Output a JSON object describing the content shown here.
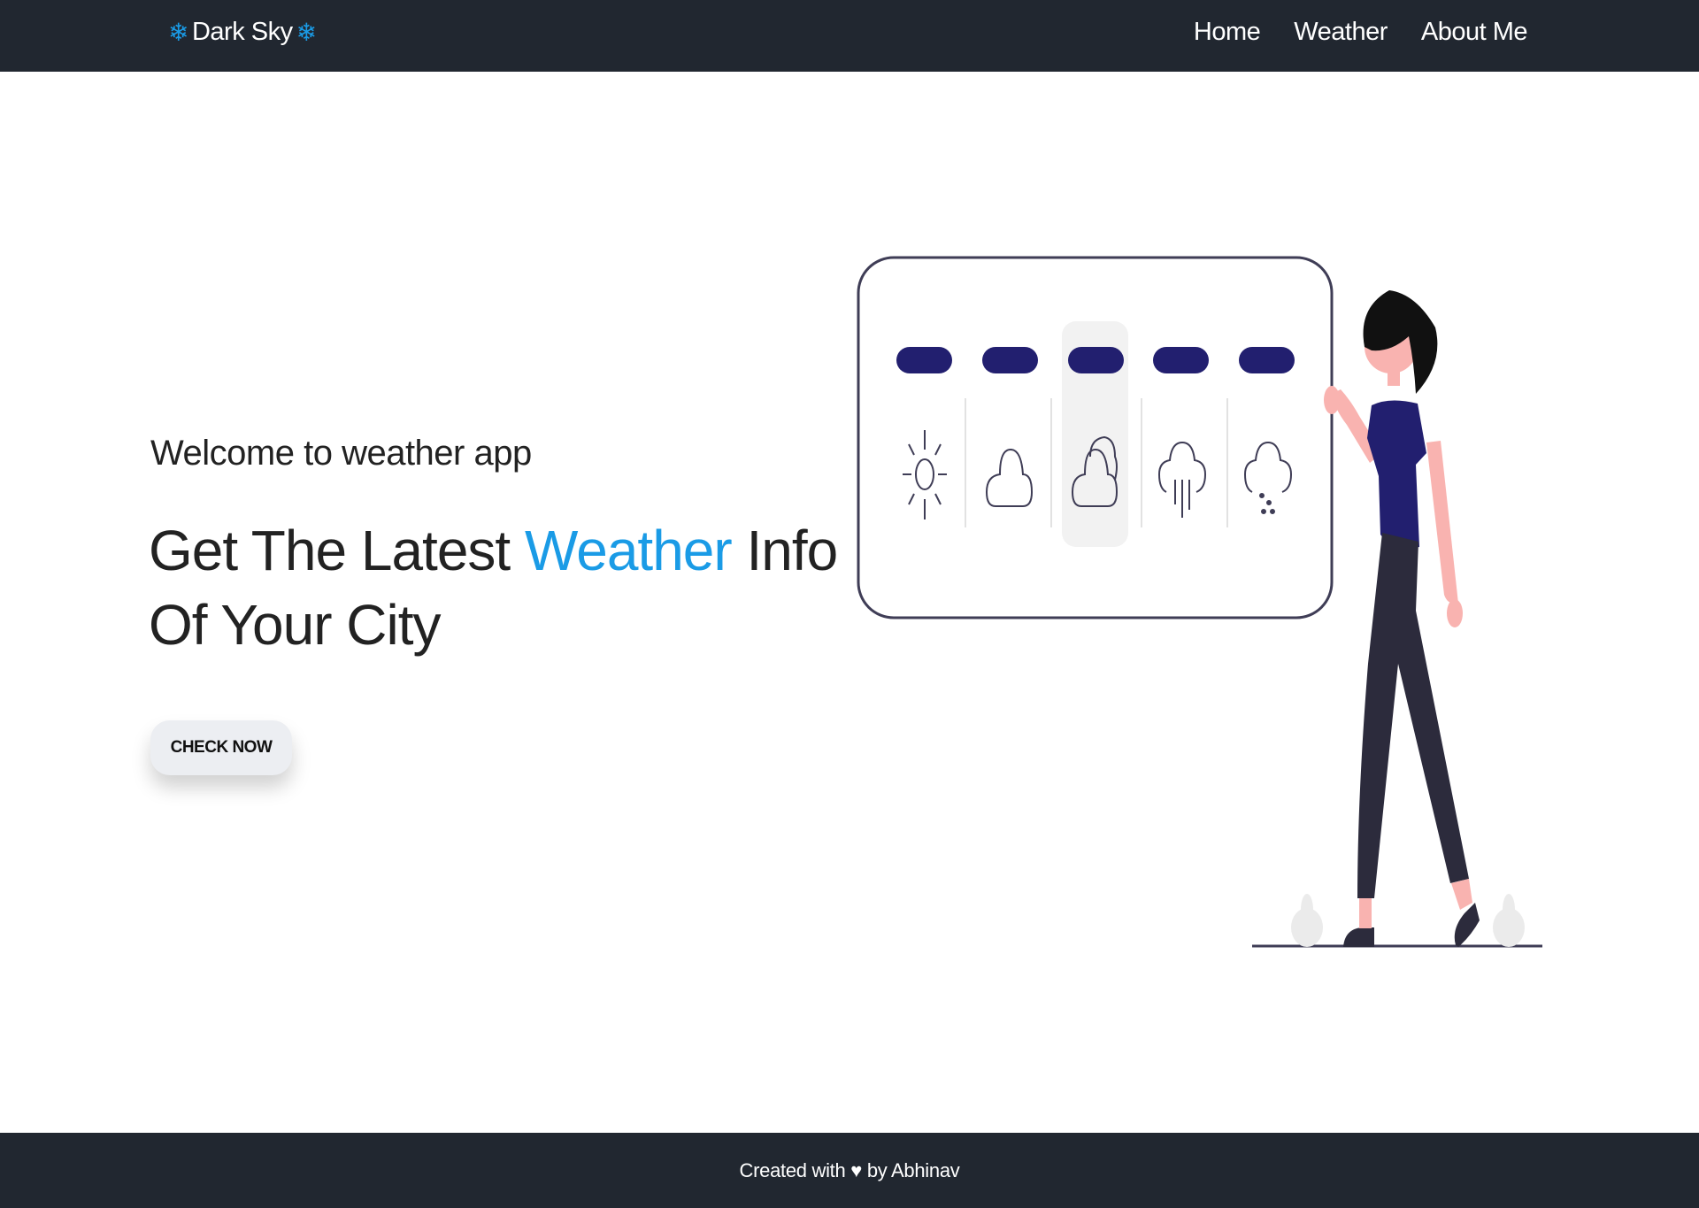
{
  "navbar": {
    "brand": "Dark Sky",
    "brand_icon": "snowflake-icon",
    "links": [
      "Home",
      "Weather",
      "About Me"
    ]
  },
  "hero": {
    "welcome": "Welcome to weather app",
    "headline_before": "Get The Latest ",
    "headline_accent": "Weather",
    "headline_after": " Info Of Your City",
    "cta_label": "CHECK NOW"
  },
  "illustration": {
    "weather_icons": [
      "sun-icon",
      "cloud-icon",
      "partly-cloudy-icon",
      "rain-icon",
      "drizzle-icon"
    ]
  },
  "footer": {
    "text": "Created with ♥ by Abhinav"
  },
  "colors": {
    "navbar_bg": "#212730",
    "accent": "#1a9be6",
    "illustration_indigo": "#221f6f",
    "skin": "#f9b3b0",
    "pants": "#2c2b3c"
  }
}
